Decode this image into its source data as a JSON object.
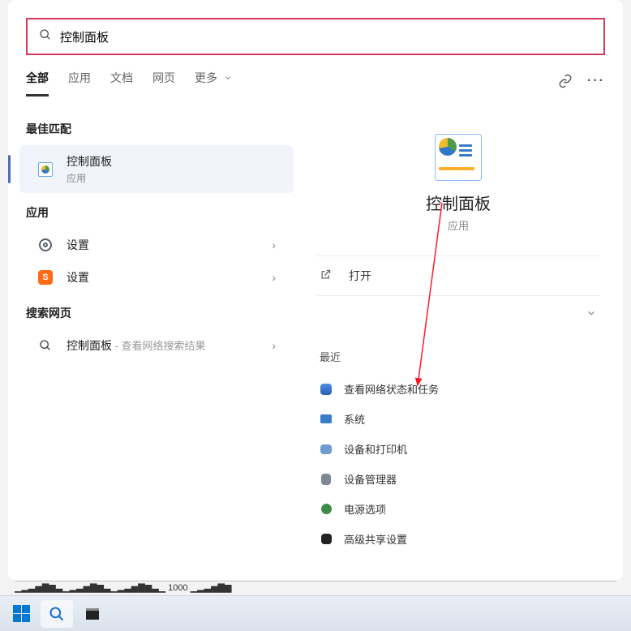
{
  "search": {
    "query": "控制面板"
  },
  "tabs": {
    "all": "全部",
    "apps": "应用",
    "docs": "文档",
    "web": "网页",
    "more": "更多"
  },
  "sections": {
    "best_match": "最佳匹配",
    "apps": "应用",
    "search_web": "搜索网页"
  },
  "results": {
    "best": {
      "title": "控制面板",
      "sub": "应用"
    },
    "apps": [
      {
        "title": "设置"
      },
      {
        "title": "设置"
      }
    ],
    "web": {
      "title": "控制面板",
      "sub": " - 查看网络搜索结果"
    }
  },
  "preview": {
    "title": "控制面板",
    "sub": "应用",
    "open": "打开",
    "recent_label": "最近",
    "recent": [
      "查看网络状态和任务",
      "系统",
      "设备和打印机",
      "设备管理器",
      "电源选项",
      "高级共享设置"
    ]
  }
}
